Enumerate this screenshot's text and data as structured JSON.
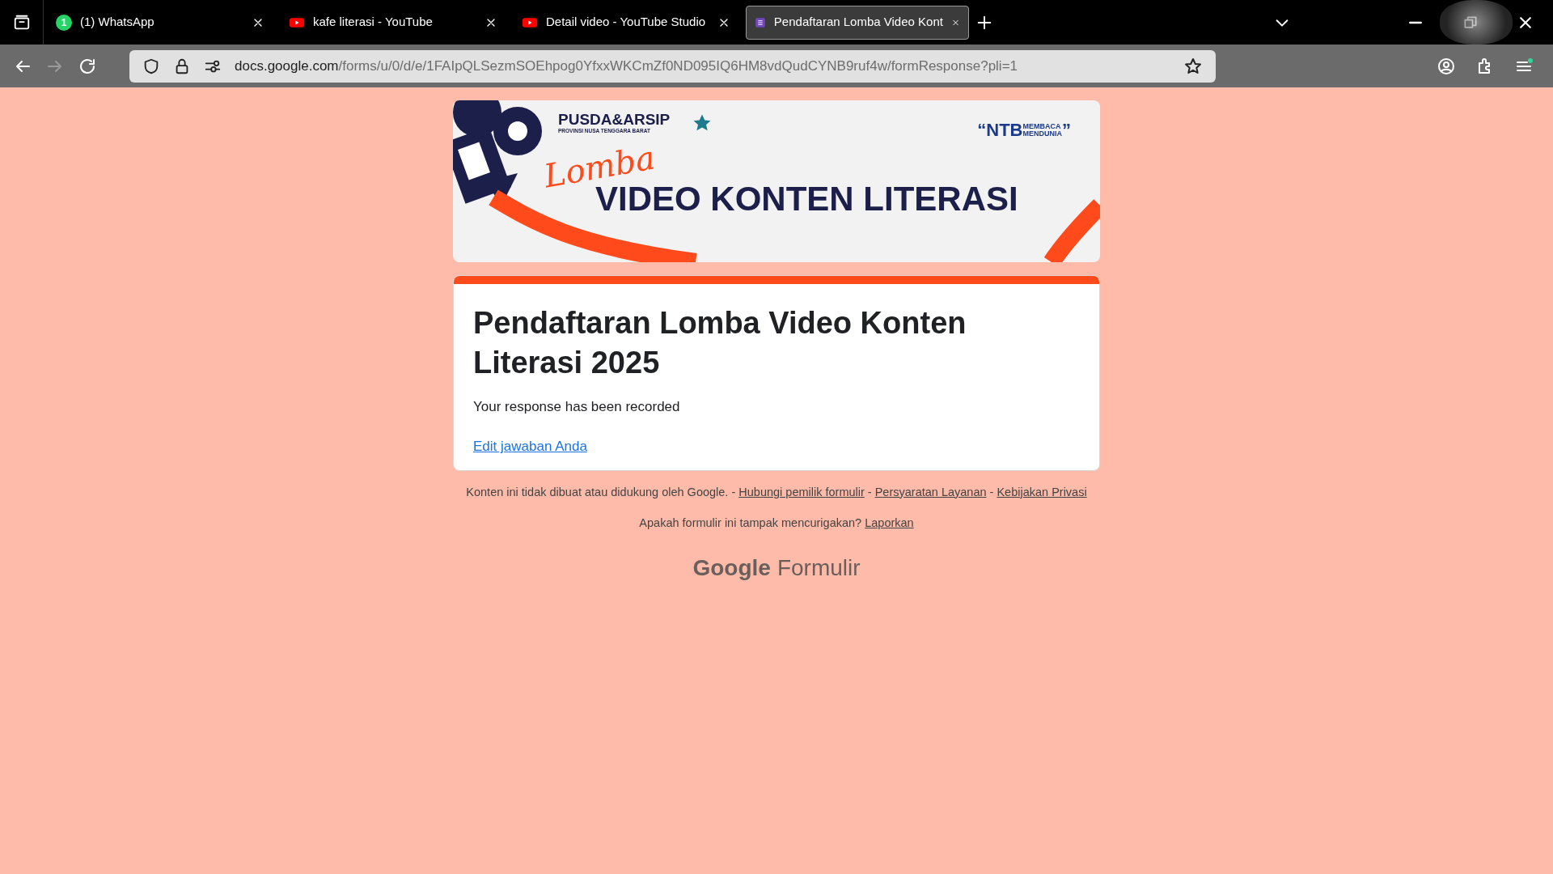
{
  "tabs": [
    {
      "kind": "whatsapp",
      "badge": "1",
      "label": "(1) WhatsApp",
      "selected": false
    },
    {
      "kind": "youtube",
      "label": "kafe literasi - YouTube",
      "selected": false
    },
    {
      "kind": "youtube",
      "label": "Detail video - YouTube Studio",
      "selected": false
    },
    {
      "kind": "forms",
      "label": "Pendaftaran Lomba Video Kont",
      "selected": true
    }
  ],
  "nav_buttons": [
    {
      "kind": "back",
      "disabled": false
    },
    {
      "kind": "forward",
      "disabled": true
    },
    {
      "kind": "reload",
      "disabled": false
    }
  ],
  "address_bar": {
    "host": "docs.google.com",
    "path": "/forms/u/0/d/e/1FAIpQLSezmSOEhpog0YfxxWKCmZf0ND095IQ6HM8vdQudCYNB9ruf4w/formResponse?pli=1"
  },
  "banner": {
    "org_name": "PUSDA&ARSIP",
    "org_subtitle": "PROVINSI NUSA TENGGARA BARAT",
    "tagline_open": "“",
    "tagline_main": "NTB",
    "tagline_top": "MEMBACA",
    "tagline_bottom": "MENDUNIA",
    "tagline_close": "”",
    "script_title": "Lomba",
    "main_title": "VIDEO KONTEN LITERASI"
  },
  "form": {
    "title": "Pendaftaran Lomba Video Konten Literasi 2025",
    "message": "Your response has been recorded",
    "edit_link": "Edit jawaban Anda"
  },
  "footer": {
    "disclaimer": [
      {
        "kind": "text",
        "text": "Konten ini tidak dibuat atau didukung oleh Google. - "
      },
      {
        "kind": "link",
        "text": "Hubungi pemilik formulir"
      },
      {
        "kind": "text",
        "text": " - "
      },
      {
        "kind": "link",
        "text": "Persyaratan Layanan"
      },
      {
        "kind": "text",
        "text": " - "
      },
      {
        "kind": "link",
        "text": "Kebijakan Privasi"
      }
    ],
    "report": [
      {
        "kind": "text",
        "text": "Apakah formulir ini tampak mencurigakan? "
      },
      {
        "kind": "link",
        "text": "Laporkan"
      }
    ],
    "brand": "Google",
    "product": "Formulir"
  }
}
